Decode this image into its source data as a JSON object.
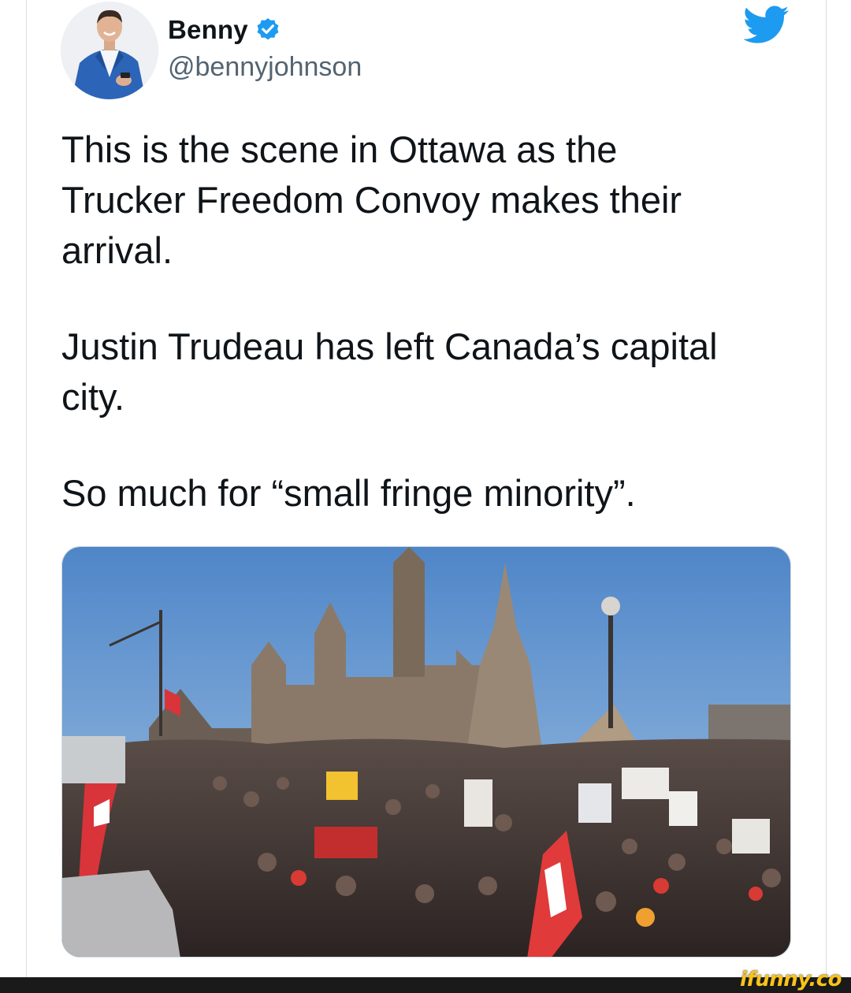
{
  "tweet": {
    "author_name": "Benny",
    "author_handle": "@bennyjohnson",
    "paragraphs": [
      "This is the scene in Ottawa as the\nTrucker Freedom Convoy makes their\narrival.",
      "Justin Trudeau has left Canada’s capital\ncity.",
      "So much for “small fringe minority”."
    ],
    "media_description_icon": "crowd-photo",
    "verified_icon": "verified-badge-icon",
    "platform_icon": "twitter-bird-icon"
  },
  "watermark": {
    "text": "ifunny.co"
  },
  "colors": {
    "twitter_blue": "#1d9bf0",
    "text_primary": "#0f1419",
    "text_secondary": "#536471",
    "watermark_yellow": "#f8c21a"
  }
}
